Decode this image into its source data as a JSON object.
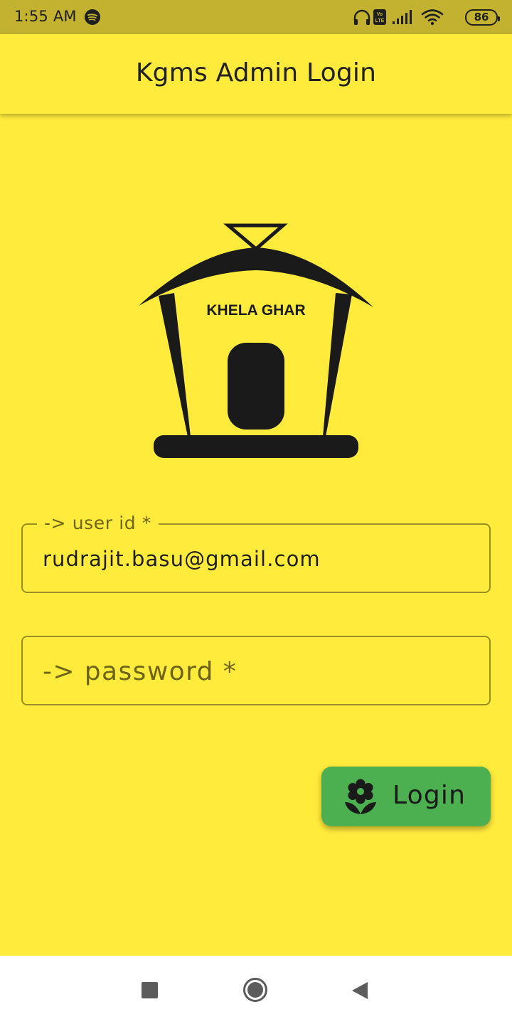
{
  "status_bar": {
    "time": "1:55 AM",
    "icons": [
      "spotify-icon",
      "headphones-icon",
      "volte-icon",
      "signal-icon",
      "wifi-icon",
      "battery-icon"
    ],
    "battery_level": "86",
    "background_color": "#c2b22f"
  },
  "app_bar": {
    "title": "Kgms Admin Login",
    "background_color": "#ffeb3b"
  },
  "logo": {
    "text": "KHELA GHAR"
  },
  "user_id_field": {
    "label": "-> user id *",
    "value": "rudrajit.basu@gmail.com"
  },
  "password_field": {
    "placeholder": "-> password *",
    "value": ""
  },
  "login_button": {
    "label": "Login",
    "icon": "flower-icon",
    "color": "#4caf50"
  },
  "nav_bar": {
    "icons": [
      "nav-recents-icon",
      "nav-home-icon",
      "nav-back-icon"
    ]
  },
  "colors": {
    "page_background": "#ffeb3b",
    "field_border": "#9c8e26",
    "label_text": "#6e6418"
  }
}
